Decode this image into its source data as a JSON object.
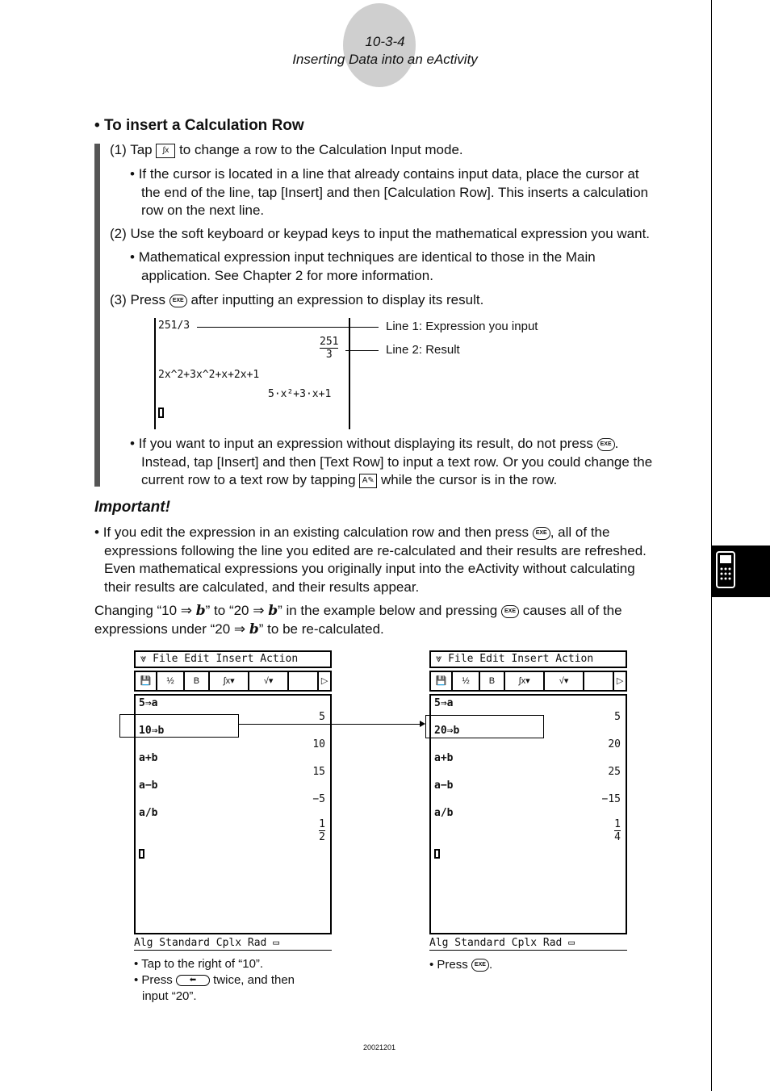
{
  "header": {
    "page_number": "10-3-4",
    "subtitle": "Inserting Data into an eActivity"
  },
  "section": {
    "title": "To insert a Calculation Row",
    "step1": {
      "prefix": "(1) Tap",
      "icon": "calc-row-icon",
      "suffix": "to change a row to the Calculation Input mode."
    },
    "step1_bullet": [
      "If the cursor is located in a line that already contains input data, place the cursor at",
      "the end of the line, tap [Insert] and then [Calculation Row]. This inserts a calculation",
      "row on the next line."
    ],
    "step2": "(2) Use the soft keyboard or keypad keys to input the mathematical expression you want.",
    "step2_bullet": [
      "Mathematical expression input techniques are identical to those in the Main",
      "application. See Chapter 2 for more information."
    ],
    "step3": {
      "prefix": "(3) Press",
      "suffix": "after inputting an expression to display its result."
    },
    "exe_label": "EXE",
    "example": {
      "line1": "251/3",
      "result_num": "251",
      "result_den": "3",
      "line3": "2x^2+3x^2+x+2x+1",
      "result2": "5·x²+3·x+1",
      "callout1": "Line 1: Expression you input",
      "callout2": "Line 2: Result"
    },
    "step3_bullet": {
      "l1a": "If you want to input an expression without displaying its result, do not press",
      "l2": "Instead, tap [Insert] and then [Text Row] to input a text row. Or you could change the",
      "l3a": "current row to a text row by tapping",
      "l3b": "while the cursor is in the row."
    }
  },
  "important": {
    "title": "Important!",
    "l1a": "If you edit the expression in an existing calculation row and then press",
    "l1b": ", all of the",
    "l2": "expressions following the line you edited are re-calculated and their results are refreshed.",
    "l3": "Even mathematical expressions you originally input into the eActivity without calculating",
    "l4": "their results are calculated, and their results appear."
  },
  "changing": {
    "l1a": "Changing “10 ⇒ ",
    "b": "b",
    "l1b": "” to “20 ⇒ ",
    "l1c": "” in the example below and pressing",
    "l1d": "causes all of the",
    "l2a": "expressions under “20 ⇒ ",
    "l2b": "” to be re-calculated."
  },
  "calc": {
    "menu": "File Edit Insert Action",
    "toolbar": [
      "B"
    ],
    "status": "Alg    Standard Cplx Rad",
    "before": {
      "rows": [
        {
          "input": "5⇒a",
          "result": "5"
        },
        {
          "input": "10⇒b",
          "result": "10"
        },
        {
          "input": "a+b",
          "result": "15"
        },
        {
          "input": "a−b",
          "result": "−5"
        },
        {
          "input": "a/b",
          "result_num": "1",
          "result_den": "2"
        }
      ]
    },
    "after": {
      "rows": [
        {
          "input": "5⇒a",
          "result": "5"
        },
        {
          "input": "20⇒b",
          "result": "20"
        },
        {
          "input": "a+b",
          "result": "25"
        },
        {
          "input": "a−b",
          "result": "−15"
        },
        {
          "input": "a/b",
          "result_num": "1",
          "result_den": "4"
        }
      ]
    }
  },
  "captions": {
    "left1": "Tap to the right of “10”.",
    "left2a": "Press",
    "left2b": "twice, and then",
    "left3": "input “20”.",
    "right1a": "Press",
    "right1b": "."
  },
  "footer": {
    "code": "20021201"
  }
}
